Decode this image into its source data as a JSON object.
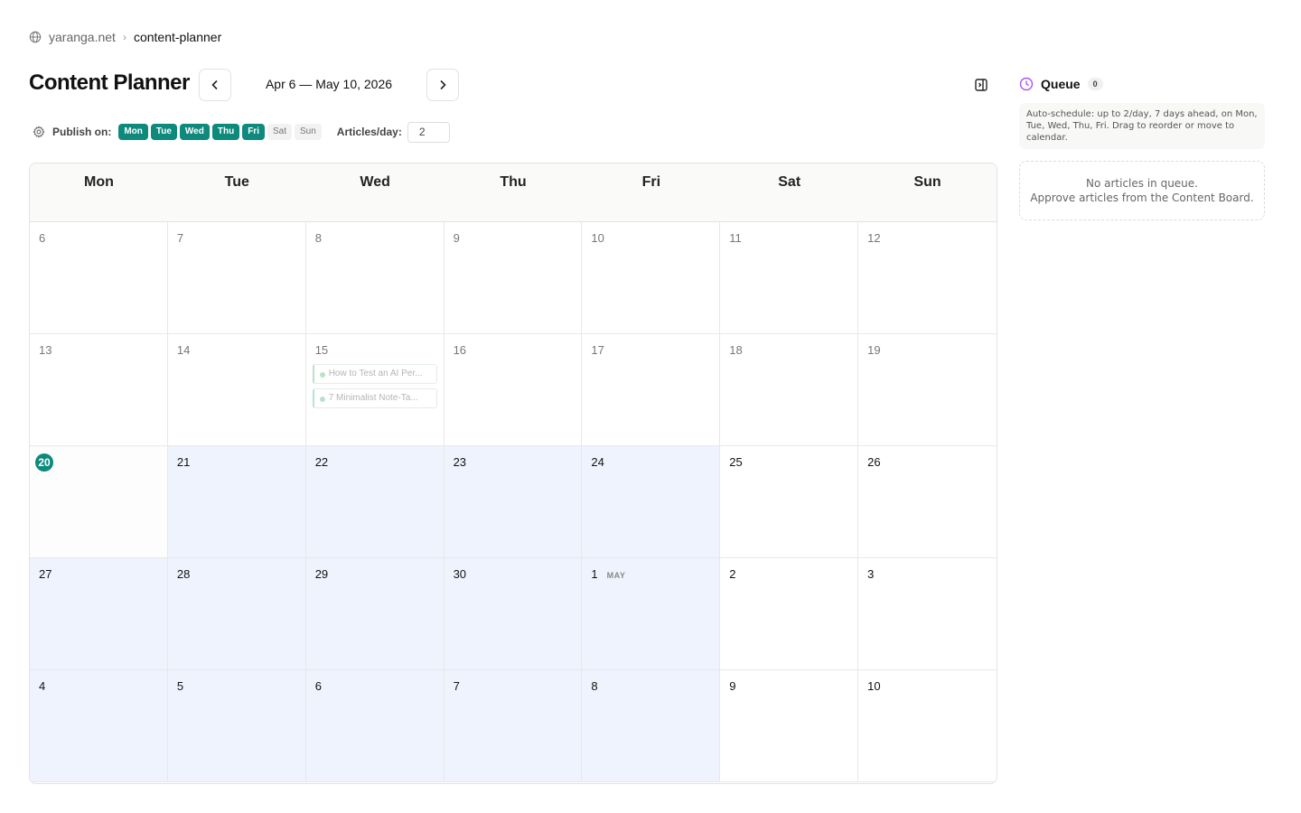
{
  "breadcrumb": {
    "site": "yaranga.net",
    "page": "content-planner"
  },
  "header": {
    "title": "Content Planner",
    "date_range": "Apr 6 — May 10, 2026"
  },
  "settings": {
    "publish_label": "Publish on:",
    "days": [
      {
        "label": "Mon",
        "active": true
      },
      {
        "label": "Tue",
        "active": true
      },
      {
        "label": "Wed",
        "active": true
      },
      {
        "label": "Thu",
        "active": true
      },
      {
        "label": "Fri",
        "active": true
      },
      {
        "label": "Sat",
        "active": false
      },
      {
        "label": "Sun",
        "active": false
      }
    ],
    "articles_label": "Articles/day:",
    "articles_value": "2"
  },
  "calendar": {
    "weekdays": [
      "Mon",
      "Tue",
      "Wed",
      "Thu",
      "Fri",
      "Sat",
      "Sun"
    ],
    "days": [
      {
        "n": "6",
        "past": true
      },
      {
        "n": "7",
        "past": true
      },
      {
        "n": "8",
        "past": true
      },
      {
        "n": "9",
        "past": true
      },
      {
        "n": "10",
        "past": true
      },
      {
        "n": "11",
        "past": true
      },
      {
        "n": "12",
        "past": true
      },
      {
        "n": "13",
        "past": true
      },
      {
        "n": "14",
        "past": true
      },
      {
        "n": "15",
        "past": true,
        "articles": [
          "How to Test an AI Per...",
          "7 Minimalist Note-Ta..."
        ]
      },
      {
        "n": "16",
        "past": true
      },
      {
        "n": "17",
        "past": true
      },
      {
        "n": "18",
        "past": true
      },
      {
        "n": "19",
        "past": true
      },
      {
        "n": "20",
        "today": true
      },
      {
        "n": "21",
        "pub": true
      },
      {
        "n": "22",
        "pub": true
      },
      {
        "n": "23",
        "pub": true
      },
      {
        "n": "24",
        "pub": true
      },
      {
        "n": "25"
      },
      {
        "n": "26"
      },
      {
        "n": "27",
        "pub": true
      },
      {
        "n": "28",
        "pub": true
      },
      {
        "n": "29",
        "pub": true
      },
      {
        "n": "30",
        "pub": true
      },
      {
        "n": "1",
        "month": "MAY",
        "pub": true
      },
      {
        "n": "2"
      },
      {
        "n": "3"
      },
      {
        "n": "4",
        "pub": true
      },
      {
        "n": "5",
        "pub": true
      },
      {
        "n": "6",
        "pub": true
      },
      {
        "n": "7",
        "pub": true
      },
      {
        "n": "8",
        "pub": true
      },
      {
        "n": "9"
      },
      {
        "n": "10"
      }
    ]
  },
  "queue": {
    "title": "Queue",
    "count": "0",
    "info": "Auto-schedule: up to 2/day, 7 days ahead, on Mon, Tue, Wed, Thu, Fri. Drag to reorder or move to calendar.",
    "empty_line1": "No articles in queue.",
    "empty_line2": "Approve articles from the Content Board."
  },
  "colors": {
    "accent": "#0d8a7c",
    "publish_day_bg": "#eef3fd",
    "queue_icon": "#a855f7"
  },
  "icons": {
    "breadcrumb": "globe-icon",
    "settings": "gear-icon",
    "queue": "clock-icon",
    "panel": "sidebar-toggle-icon"
  }
}
